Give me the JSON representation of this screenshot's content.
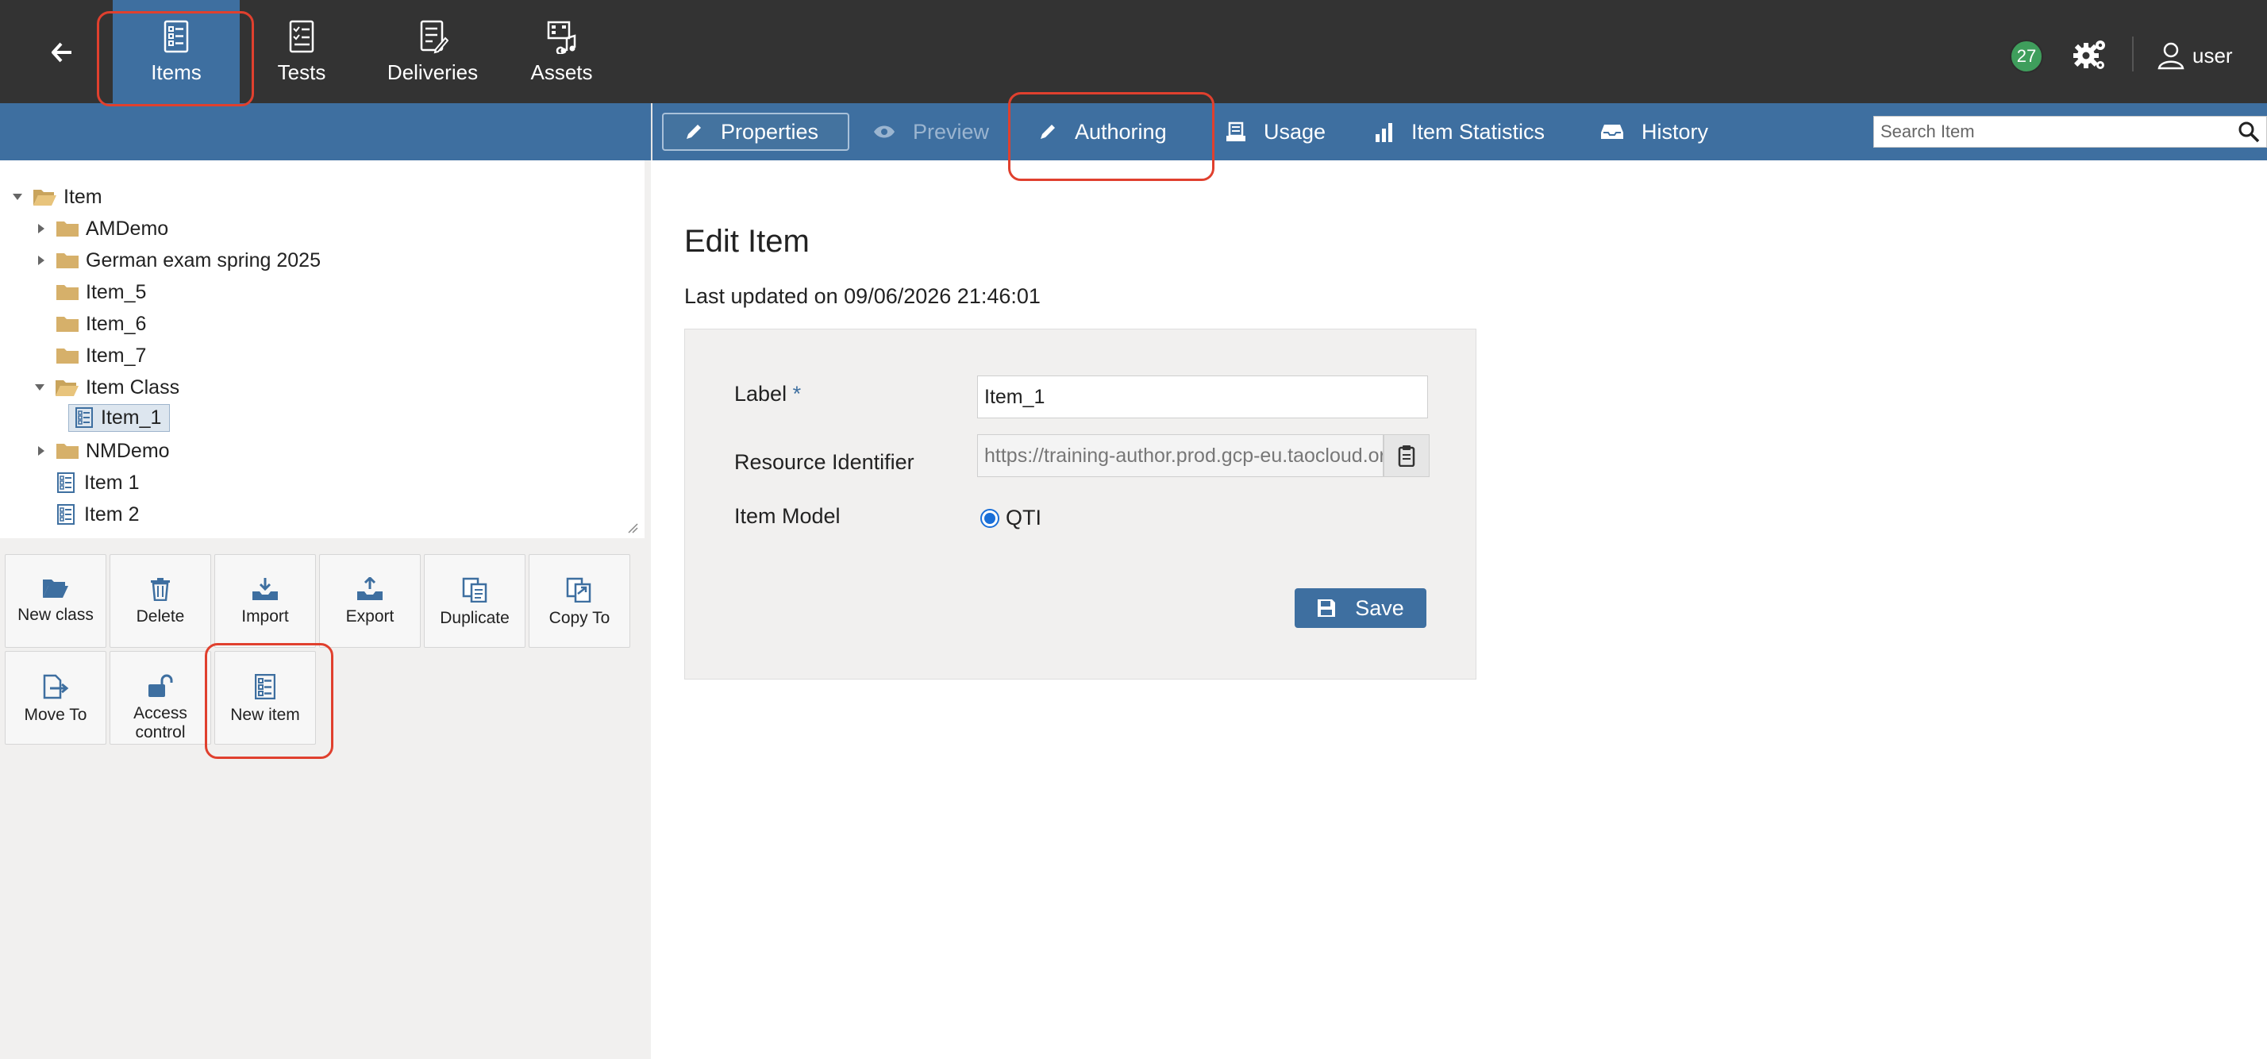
{
  "topbar": {
    "tabs": [
      {
        "label": "Items",
        "icon": "items-icon",
        "active": true
      },
      {
        "label": "Tests",
        "icon": "tests-icon"
      },
      {
        "label": "Deliveries",
        "icon": "deliveries-icon"
      },
      {
        "label": "Assets",
        "icon": "assets-icon"
      }
    ],
    "notification_count": "27",
    "user_label": "user"
  },
  "actionbar": {
    "properties": "Properties",
    "preview": "Preview",
    "authoring": "Authoring",
    "usage": "Usage",
    "item_statistics": "Item Statistics",
    "history": "History",
    "search_placeholder": "Search Item"
  },
  "tree": {
    "nodes": [
      {
        "label": "Item",
        "type": "folder-open",
        "expanded": true
      },
      {
        "label": "AMDemo",
        "type": "folder"
      },
      {
        "label": "German exam spring 2025",
        "type": "folder"
      },
      {
        "label": "Item_5",
        "type": "folder"
      },
      {
        "label": "Item_6",
        "type": "folder"
      },
      {
        "label": "Item_7",
        "type": "folder"
      },
      {
        "label": "Item Class",
        "type": "folder-open",
        "expanded": true
      },
      {
        "label": "Item_1",
        "type": "item",
        "selected": true
      },
      {
        "label": "NMDemo",
        "type": "folder"
      },
      {
        "label": "Item 1",
        "type": "item"
      },
      {
        "label": "Item 2",
        "type": "item"
      }
    ]
  },
  "actions": {
    "new_class": "New class",
    "delete": "Delete",
    "import": "Import",
    "export": "Export",
    "duplicate": "Duplicate",
    "copy_to": "Copy To",
    "move_to": "Move To",
    "access_control_1": "Access",
    "access_control_2": "control",
    "new_item": "New item"
  },
  "form": {
    "title": "Edit Item",
    "last_updated": "Last updated on 09/06/2026 21:46:01",
    "label_label": "Label",
    "label_required": "*",
    "label_value": "Item_1",
    "resource_identifier_label": "Resource Identifier",
    "resource_identifier_value": "https://training-author.prod.gcp-eu.taocloud.org/",
    "item_model_label": "Item Model",
    "item_model_option": "QTI",
    "save_label": "Save"
  },
  "colors": {
    "topbar_bg": "#333333",
    "brand_blue": "#3e6fa0",
    "panel_bg": "#f1f0ef",
    "badge_green": "#3f9e5c",
    "annotation_red": "#e0402e"
  }
}
